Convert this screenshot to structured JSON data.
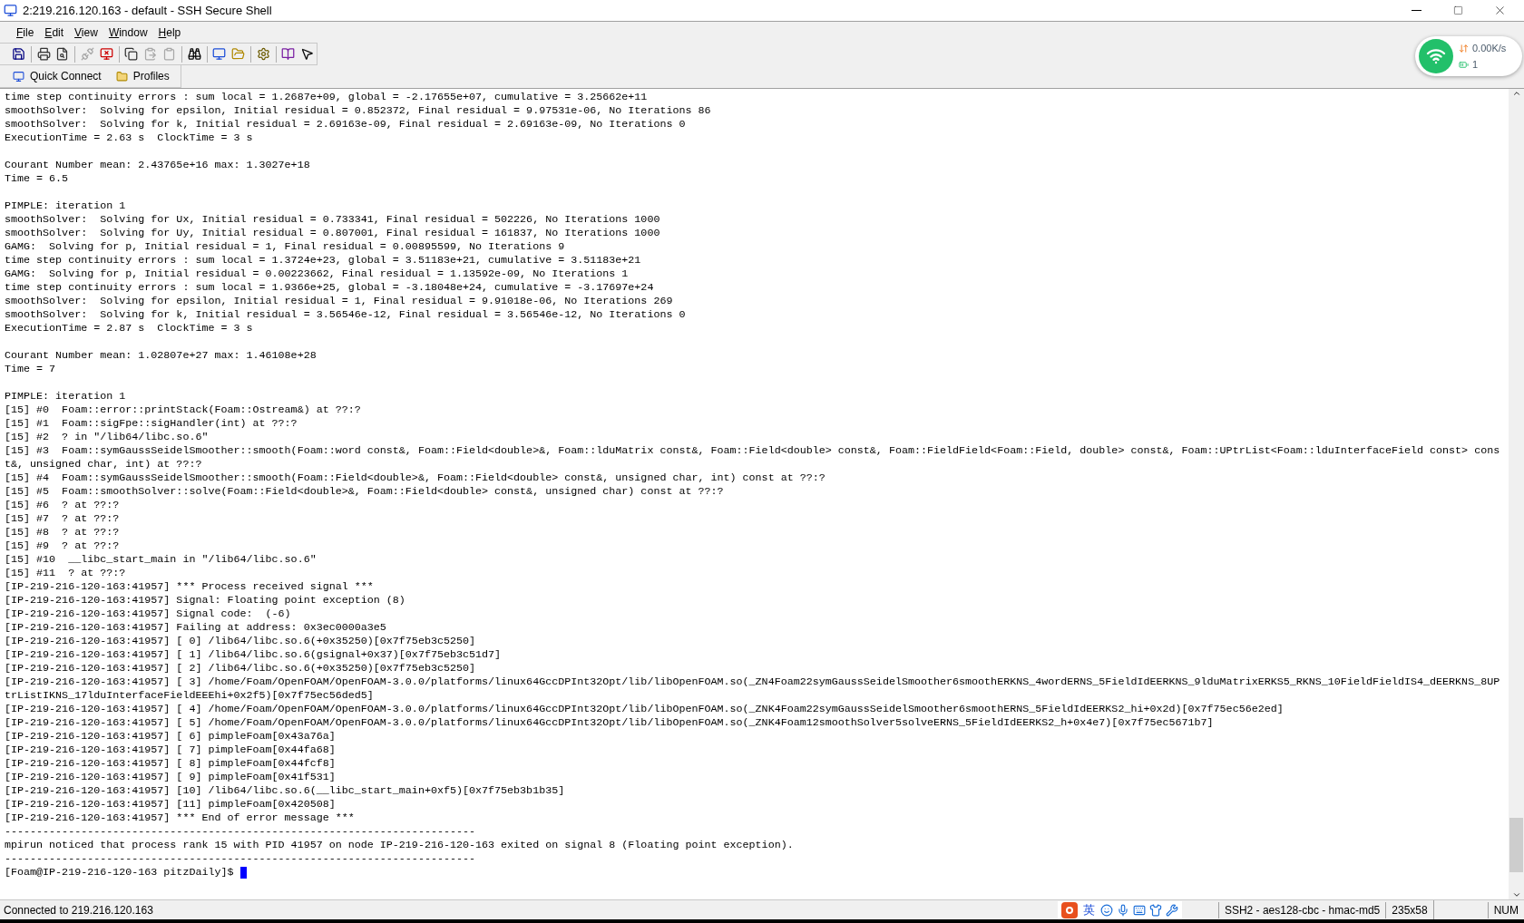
{
  "window": {
    "title": "2:219.216.120.163 - default - SSH Secure Shell"
  },
  "menu": [
    "File",
    "Edit",
    "View",
    "Window",
    "Help"
  ],
  "toolbar": [
    {
      "disabled": false
    },
    {
      "disabled": false
    },
    {
      "disabled": false
    },
    {
      "disabled": true
    },
    {
      "disabled": false
    },
    {
      "disabled": false
    },
    {
      "disabled": true
    },
    {
      "disabled": true
    },
    {
      "disabled": false
    },
    {
      "disabled": false
    },
    {
      "disabled": false
    },
    {
      "disabled": false
    },
    {
      "disabled": false
    },
    {
      "disabled": false
    }
  ],
  "shortcuts": [
    "Quick Connect",
    "Profiles"
  ],
  "network_widget": {
    "speed": "0.00K/s",
    "count": "1"
  },
  "terminal": {
    "blocks": [
      [
        "time step continuity errors : sum local = 1.2687e+09, global = -2.17655e+07, cumulative = 3.25662e+11",
        "smoothSolver:  Solving for epsilon, Initial residual = 0.852372, Final residual = 9.97531e-06, No Iterations 86",
        "smoothSolver:  Solving for k, Initial residual = 2.69163e-09, Final residual = 2.69163e-09, No Iterations 0",
        "ExecutionTime = 2.63 s  ClockTime = 3 s"
      ],
      [
        "Courant Number mean: 2.43765e+16 max: 1.3027e+18",
        "Time = 6.5"
      ],
      [
        "PIMPLE: iteration 1",
        "smoothSolver:  Solving for Ux, Initial residual = 0.733341, Final residual = 502226, No Iterations 1000",
        "smoothSolver:  Solving for Uy, Initial residual = 0.807001, Final residual = 161837, No Iterations 1000",
        "GAMG:  Solving for p, Initial residual = 1, Final residual = 0.00895599, No Iterations 9",
        "time step continuity errors : sum local = 1.3724e+23, global = 3.51183e+21, cumulative = 3.51183e+21",
        "GAMG:  Solving for p, Initial residual = 0.00223662, Final residual = 1.13592e-09, No Iterations 1",
        "time step continuity errors : sum local = 1.9366e+25, global = -3.18048e+24, cumulative = -3.17697e+24",
        "smoothSolver:  Solving for epsilon, Initial residual = 1, Final residual = 9.91018e-06, No Iterations 269",
        "smoothSolver:  Solving for k, Initial residual = 3.56546e-12, Final residual = 3.56546e-12, No Iterations 0",
        "ExecutionTime = 2.87 s  ClockTime = 3 s"
      ],
      [
        "Courant Number mean: 1.02807e+27 max: 1.46108e+28",
        "Time = 7"
      ],
      [
        "PIMPLE: iteration 1",
        "[15] #0  Foam::error::printStack(Foam::Ostream&) at ??:?",
        "[15] #1  Foam::sigFpe::sigHandler(int) at ??:?",
        "[15] #2  ? in \"/lib64/libc.so.6\"",
        "[15] #3  Foam::symGaussSeidelSmoother::smooth(Foam::word const&, Foam::Field<double>&, Foam::lduMatrix const&, Foam::Field<double> const&, Foam::FieldField<Foam::Field, double> const&, Foam::UPtrList<Foam::lduInterfaceField const> cons",
        "t&, unsigned char, int) at ??:?",
        "[15] #4  Foam::symGaussSeidelSmoother::smooth(Foam::Field<double>&, Foam::Field<double> const&, unsigned char, int) const at ??:?",
        "[15] #5  Foam::smoothSolver::solve(Foam::Field<double>&, Foam::Field<double> const&, unsigned char) const at ??:?",
        "[15] #6  ? at ??:?",
        "[15] #7  ? at ??:?",
        "[15] #8  ? at ??:?",
        "[15] #9  ? at ??:?",
        "[15] #10  __libc_start_main in \"/lib64/libc.so.6\"",
        "[15] #11  ? at ??:?",
        "[IP-219-216-120-163:41957] *** Process received signal ***",
        "[IP-219-216-120-163:41957] Signal: Floating point exception (8)",
        "[IP-219-216-120-163:41957] Signal code:  (-6)",
        "[IP-219-216-120-163:41957] Failing at address: 0x3ec0000a3e5",
        "[IP-219-216-120-163:41957] [ 0] /lib64/libc.so.6(+0x35250)[0x7f75eb3c5250]",
        "[IP-219-216-120-163:41957] [ 1] /lib64/libc.so.6(gsignal+0x37)[0x7f75eb3c51d7]",
        "[IP-219-216-120-163:41957] [ 2] /lib64/libc.so.6(+0x35250)[0x7f75eb3c5250]",
        "[IP-219-216-120-163:41957] [ 3] /home/Foam/OpenFOAM/OpenFOAM-3.0.0/platforms/linux64GccDPInt32Opt/lib/libOpenFOAM.so(_ZN4Foam22symGaussSeidelSmoother6smoothERKNS_4wordERNS_5FieldIdEERKNS_9lduMatrixERKS5_RKNS_10FieldFieldIS4_dEERKNS_8UP",
        "trListIKNS_17lduInterfaceFieldEEEhi+0x2f5)[0x7f75ec56ded5]",
        "[IP-219-216-120-163:41957] [ 4] /home/Foam/OpenFOAM/OpenFOAM-3.0.0/platforms/linux64GccDPInt32Opt/lib/libOpenFOAM.so(_ZNK4Foam22symGaussSeidelSmoother6smoothERNS_5FieldIdEERKS2_hi+0x2d)[0x7f75ec56e2ed]",
        "[IP-219-216-120-163:41957] [ 5] /home/Foam/OpenFOAM/OpenFOAM-3.0.0/platforms/linux64GccDPInt32Opt/lib/libOpenFOAM.so(_ZNK4Foam12smoothSolver5solveERNS_5FieldIdEERKS2_h+0x4e7)[0x7f75ec5671b7]",
        "[IP-219-216-120-163:41957] [ 6] pimpleFoam[0x43a76a]",
        "[IP-219-216-120-163:41957] [ 7] pimpleFoam[0x44fa68]",
        "[IP-219-216-120-163:41957] [ 8] pimpleFoam[0x44fcf8]",
        "[IP-219-216-120-163:41957] [ 9] pimpleFoam[0x41f531]",
        "[IP-219-216-120-163:41957] [10] /lib64/libc.so.6(__libc_start_main+0xf5)[0x7f75eb3b1b35]",
        "[IP-219-216-120-163:41957] [11] pimpleFoam[0x420508]",
        "[IP-219-216-120-163:41957] *** End of error message ***",
        "--------------------------------------------------------------------------",
        "mpirun noticed that process rank 15 with PID 41957 on node IP-219-216-120-163 exited on signal 8 (Floating point exception).",
        "--------------------------------------------------------------------------"
      ]
    ],
    "prompt": "[Foam@IP-219-216-120-163 pitzDaily]$"
  },
  "status_bar": {
    "connection": "Connected to 219.216.120.163",
    "ime_label": "英",
    "cipher": "SSH2 - aes128-cbc - hmac-md5",
    "size": "235x58",
    "num": "NUM"
  }
}
